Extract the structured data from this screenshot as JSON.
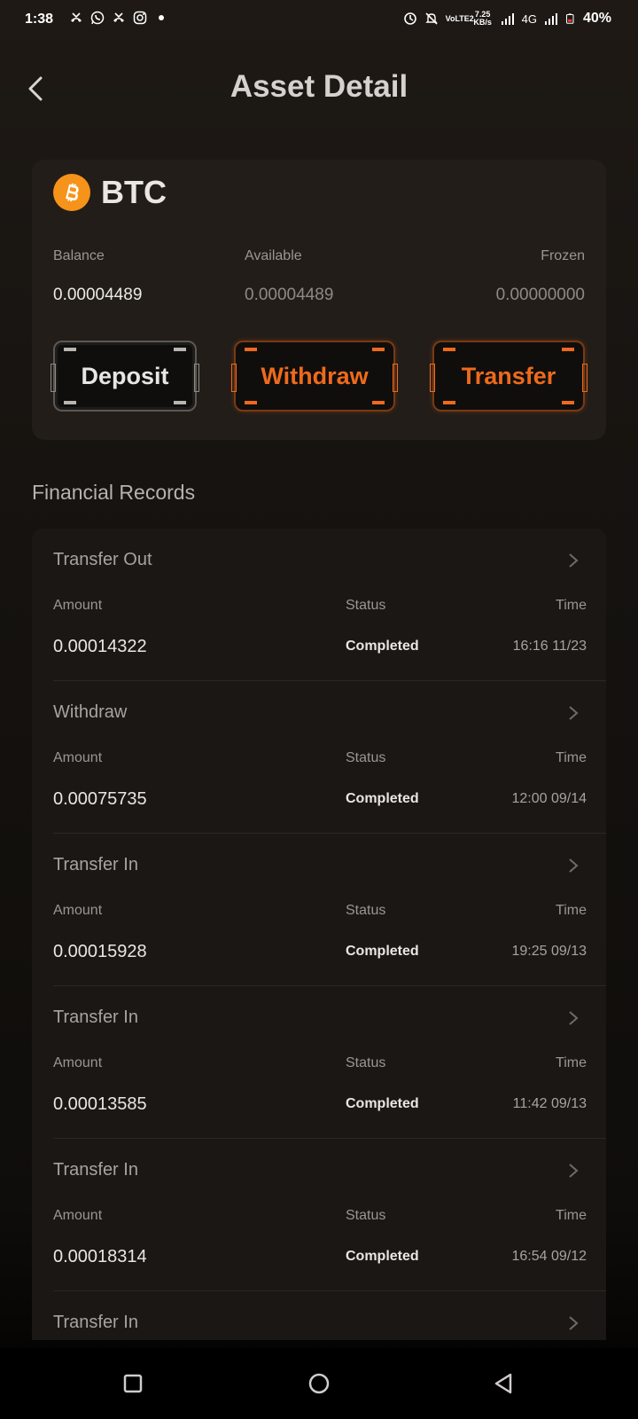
{
  "status_bar": {
    "time": "1:38",
    "network_label": "4G",
    "speed_value": "7.25",
    "speed_unit": "KB/s",
    "volte_label": "VoLTE2",
    "battery_percent": "40%"
  },
  "header": {
    "title": "Asset Detail"
  },
  "asset": {
    "coin": "BTC",
    "coin_icon": "bitcoin-icon",
    "coin_color": "#f6931a",
    "balance_label": "Balance",
    "available_label": "Available",
    "frozen_label": "Frozen",
    "balance": "0.00004489",
    "available": "0.00004489",
    "frozen": "0.00000000"
  },
  "actions": {
    "deposit": "Deposit",
    "withdraw": "Withdraw",
    "transfer": "Transfer",
    "accent_color": "#ee6a1c"
  },
  "records": {
    "title": "Financial Records",
    "amount_label": "Amount",
    "status_label": "Status",
    "time_label": "Time",
    "items": [
      {
        "type": "Transfer Out",
        "amount": "0.00014322",
        "status": "Completed",
        "time": "16:16 11/23"
      },
      {
        "type": "Withdraw",
        "amount": "0.00075735",
        "status": "Completed",
        "time": "12:00 09/14"
      },
      {
        "type": "Transfer In",
        "amount": "0.00015928",
        "status": "Completed",
        "time": "19:25 09/13"
      },
      {
        "type": "Transfer In",
        "amount": "0.00013585",
        "status": "Completed",
        "time": "11:42 09/13"
      },
      {
        "type": "Transfer In",
        "amount": "0.00018314",
        "status": "Completed",
        "time": "16:54 09/12"
      },
      {
        "type": "Transfer In"
      }
    ]
  }
}
